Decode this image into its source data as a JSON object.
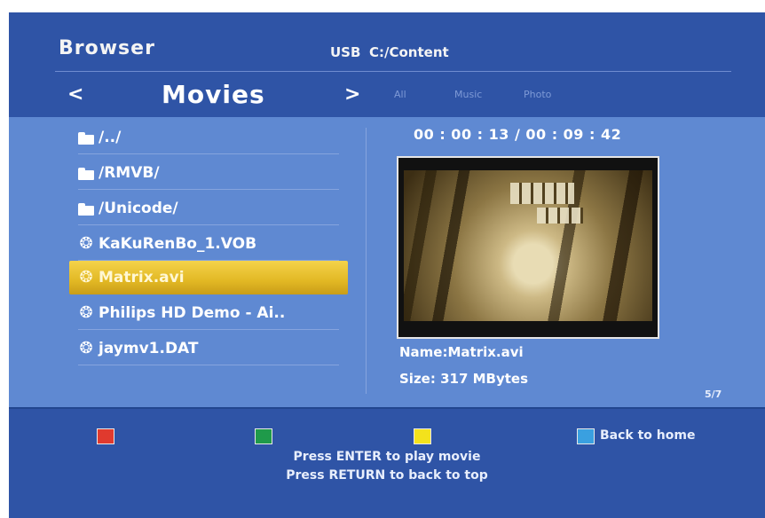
{
  "header": {
    "title": "Browser",
    "device": "USB",
    "path": "C:/Content",
    "nav_left": "<",
    "category": "Movies",
    "nav_right": ">",
    "filters": [
      "All",
      "Music",
      "Photo"
    ]
  },
  "list": {
    "items": [
      {
        "icon": "folder-icon",
        "label": "/../"
      },
      {
        "icon": "folder-icon",
        "label": "/RMVB/"
      },
      {
        "icon": "folder-icon",
        "label": "/Unicode/"
      },
      {
        "icon": "film-reel-icon",
        "label": "KaKuRenBo_1.VOB"
      },
      {
        "icon": "film-reel-icon",
        "label": "Matrix.avi"
      },
      {
        "icon": "film-reel-icon",
        "label": "Philips HD Demo - Ai.."
      },
      {
        "icon": "film-reel-icon",
        "label": "jaymv1.DAT"
      }
    ],
    "selected_index": 4,
    "reel_glyph": "❂"
  },
  "detail": {
    "time": "00 : 00 : 13  / 00 : 09 : 42",
    "name": "Name:Matrix.avi",
    "size": "Size: 317 MBytes",
    "page": "5/7"
  },
  "footer": {
    "keys": [
      {
        "name": "red",
        "color": "#e03a2e"
      },
      {
        "name": "green",
        "color": "#1f9a4a"
      },
      {
        "name": "yellow",
        "color": "#f3e21c"
      },
      {
        "name": "blue",
        "color": "#3aa0e0"
      }
    ],
    "blue_label": "Back to home",
    "hint_enter": "Press ENTER to play movie",
    "hint_return": "Press RETURN to back to top"
  }
}
